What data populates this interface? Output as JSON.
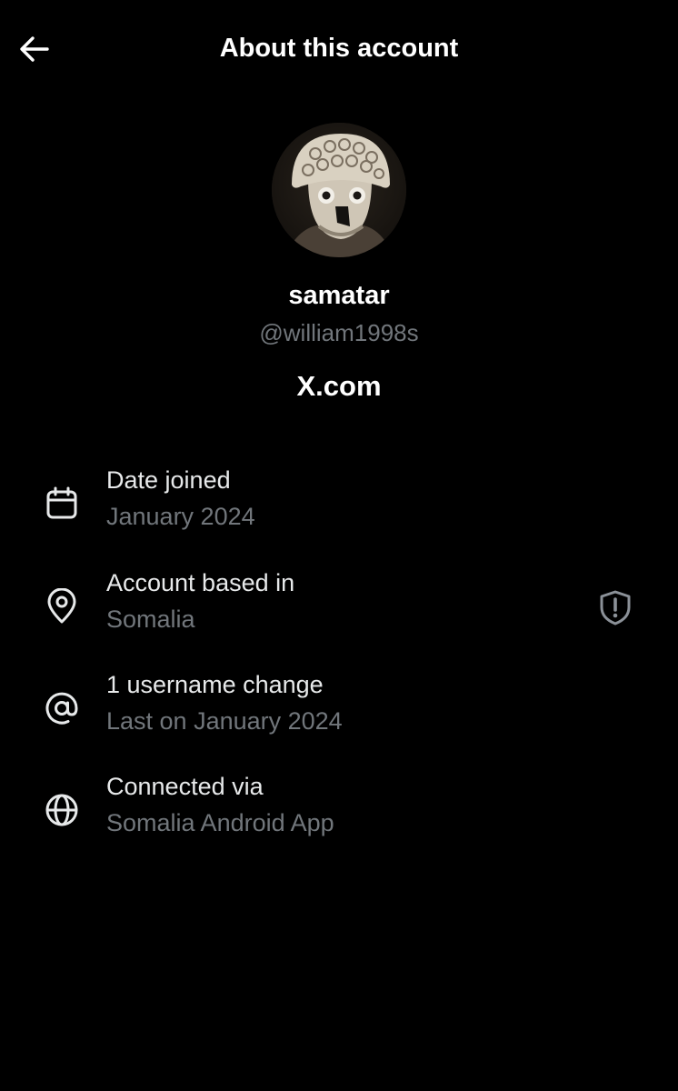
{
  "header": {
    "title": "About this account",
    "back_icon": "arrow-left-icon"
  },
  "profile": {
    "display_name": "samatar",
    "handle": "@william1998s",
    "site": "X.com",
    "avatar_icon": "carved-stone-face-avatar"
  },
  "details": [
    {
      "icon": "calendar-icon",
      "title": "Date joined",
      "subtitle": "January 2024"
    },
    {
      "icon": "location-pin-icon",
      "title": "Account based in",
      "subtitle": "Somalia",
      "badge_icon": "shield-alert-icon"
    },
    {
      "icon": "at-sign-icon",
      "title": "1 username change",
      "subtitle": "Last on January 2024"
    },
    {
      "icon": "globe-icon",
      "title": "Connected via",
      "subtitle": "Somalia Android App"
    }
  ],
  "colors": {
    "background": "#000000",
    "primary_text": "#e7e9ea",
    "secondary_text": "#71767b"
  }
}
